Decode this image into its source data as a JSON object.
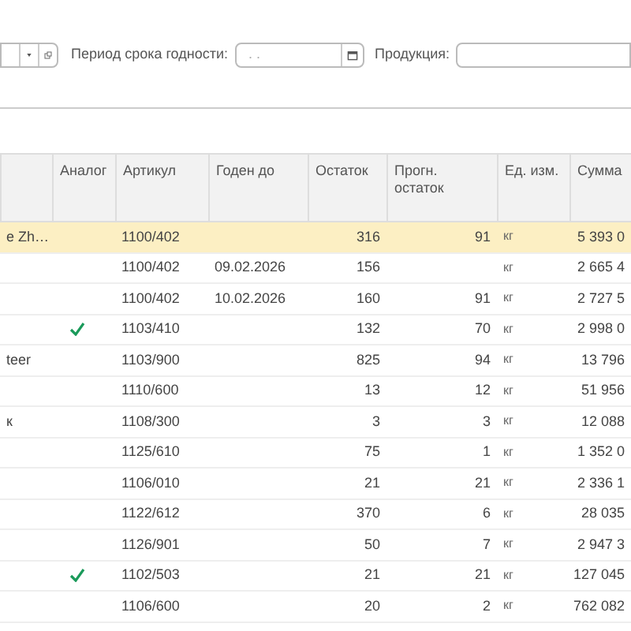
{
  "filters": {
    "period_label": "Период срока годности:",
    "period_value": ". .",
    "product_label": "Продукция:"
  },
  "table": {
    "columns": [
      "",
      "Аналог",
      "Артикул",
      "Годен до",
      "Остаток",
      "Прогн. остаток",
      "Ед. изм.",
      "Сумма"
    ],
    "rows": [
      {
        "name": "e Zh…",
        "analog": false,
        "article": "1100/402",
        "expiry": "",
        "stock": "316",
        "forecast": "91",
        "unit": "кг",
        "sum": "5 393 0",
        "selected": true
      },
      {
        "name": "",
        "analog": false,
        "article": "1100/402",
        "expiry": "09.02.2026",
        "stock": "156",
        "forecast": "",
        "unit": "кг",
        "sum": "2 665 4",
        "selected": false
      },
      {
        "name": "",
        "analog": false,
        "article": "1100/402",
        "expiry": "10.02.2026",
        "stock": "160",
        "forecast": "91",
        "unit": "кг",
        "sum": "2 727 5",
        "selected": false
      },
      {
        "name": "",
        "analog": true,
        "article": "1103/410",
        "expiry": "",
        "stock": "132",
        "forecast": "70",
        "unit": "кг",
        "sum": "2 998 0",
        "selected": false
      },
      {
        "name": "teer",
        "analog": false,
        "article": "1103/900",
        "expiry": "",
        "stock": "825",
        "forecast": "94",
        "unit": "кг",
        "sum": "13 796",
        "selected": false
      },
      {
        "name": "",
        "analog": false,
        "article": "1110/600",
        "expiry": "",
        "stock": "13",
        "forecast": "12",
        "unit": "кг",
        "sum": "51 956",
        "selected": false
      },
      {
        "name": "к",
        "analog": false,
        "article": "1108/300",
        "expiry": "",
        "stock": "3",
        "forecast": "3",
        "unit": "кг",
        "sum": "12 088",
        "selected": false
      },
      {
        "name": "",
        "analog": false,
        "article": "1125/610",
        "expiry": "",
        "stock": "75",
        "forecast": "1",
        "unit": "кг",
        "sum": "1 352 0",
        "selected": false
      },
      {
        "name": "",
        "analog": false,
        "article": "1106/010",
        "expiry": "",
        "stock": "21",
        "forecast": "21",
        "unit": "кг",
        "sum": "2 336 1",
        "selected": false
      },
      {
        "name": "",
        "analog": false,
        "article": "1122/612",
        "expiry": "",
        "stock": "370",
        "forecast": "6",
        "unit": "кг",
        "sum": "28 035",
        "selected": false
      },
      {
        "name": "",
        "analog": false,
        "article": "1126/901",
        "expiry": "",
        "stock": "50",
        "forecast": "7",
        "unit": "кг",
        "sum": "2 947 3",
        "selected": false
      },
      {
        "name": "",
        "analog": true,
        "article": "1102/503",
        "expiry": "",
        "stock": "21",
        "forecast": "21",
        "unit": "кг",
        "sum": "127 045",
        "selected": false
      },
      {
        "name": "",
        "analog": false,
        "article": "1106/600",
        "expiry": "",
        "stock": "20",
        "forecast": "2",
        "unit": "кг",
        "sum": "762 082",
        "selected": false
      }
    ]
  }
}
